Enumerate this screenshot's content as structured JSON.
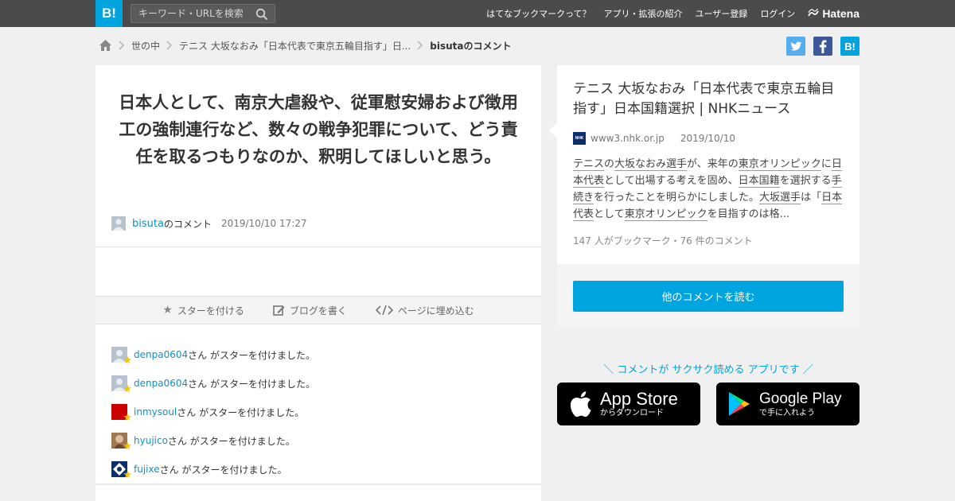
{
  "header": {
    "logo": "B!",
    "search_placeholder": "キーワード・URLを検索",
    "nav": [
      "はてなブックマークって？",
      "アプリ・拡張の紹介",
      "ユーザー登録",
      "ログイン"
    ],
    "brand": "Hatena"
  },
  "breadcrumb": {
    "items": [
      "世の中",
      "テニス 大坂なおみ「日本代表で東京五輪目指す」日...",
      "bisutaのコメント"
    ]
  },
  "share": {
    "hatena": "B!"
  },
  "comment": {
    "text": "日本人として、南京大虐殺や、従軍慰安婦および徴用工の強制連行など、数々の戦争犯罪について、どう責任を取るつもりなのか、釈明してほしいと思う。",
    "user": "bisuta",
    "user_suffix": "のコメント",
    "time": "2019/10/10 17:27"
  },
  "actions": {
    "star": "スターを付ける",
    "blog": "ブログを書く",
    "embed": "ページに埋め込む"
  },
  "stars": {
    "suffix": "さん がスターを付けました。",
    "users": [
      "denpa0604",
      "denpa0604",
      "inmysoul",
      "hyujico",
      "fujixe"
    ]
  },
  "entry": {
    "title": "テニス 大坂なおみ「日本代表で東京五輪目指す」日本国籍選択 | NHKニュース",
    "favicon_text": "NHK",
    "domain": "www3.nhk.or.jp",
    "date": "2019/10/10",
    "summary": {
      "s1": "テニス",
      "s2": "の",
      "s3": "大坂なおみ選手",
      "s4": "が、来年の",
      "s5": "東京オリンピック",
      "s6": "に",
      "s7": "日本代表",
      "s8": "として出場する考えを固め、",
      "s9": "日本国籍",
      "s10": "を選択する",
      "s11": "手続き",
      "s12": "を行ったことを明らかにしました。",
      "s13": "大坂選手",
      "s14": "は「",
      "s15": "日本代表",
      "s16": "として",
      "s17": "東京オリンピック",
      "s18": "を目指すのは格..."
    },
    "counts": "147 人がブックマーク・76 件のコメント",
    "read_more": "他のコメントを読む"
  },
  "app_promo": {
    "tagline": "＼ コメントが サクサク読める アプリです ／",
    "appstore_big": "App Store",
    "appstore_small": "からダウンロード",
    "googleplay_big": "Google Play",
    "googleplay_small": "で手に入れよう"
  },
  "colors": {
    "accent": "#00a4de",
    "topbar": "#4b4b4b",
    "link": "#0f91c9",
    "star": "#f5c400"
  }
}
